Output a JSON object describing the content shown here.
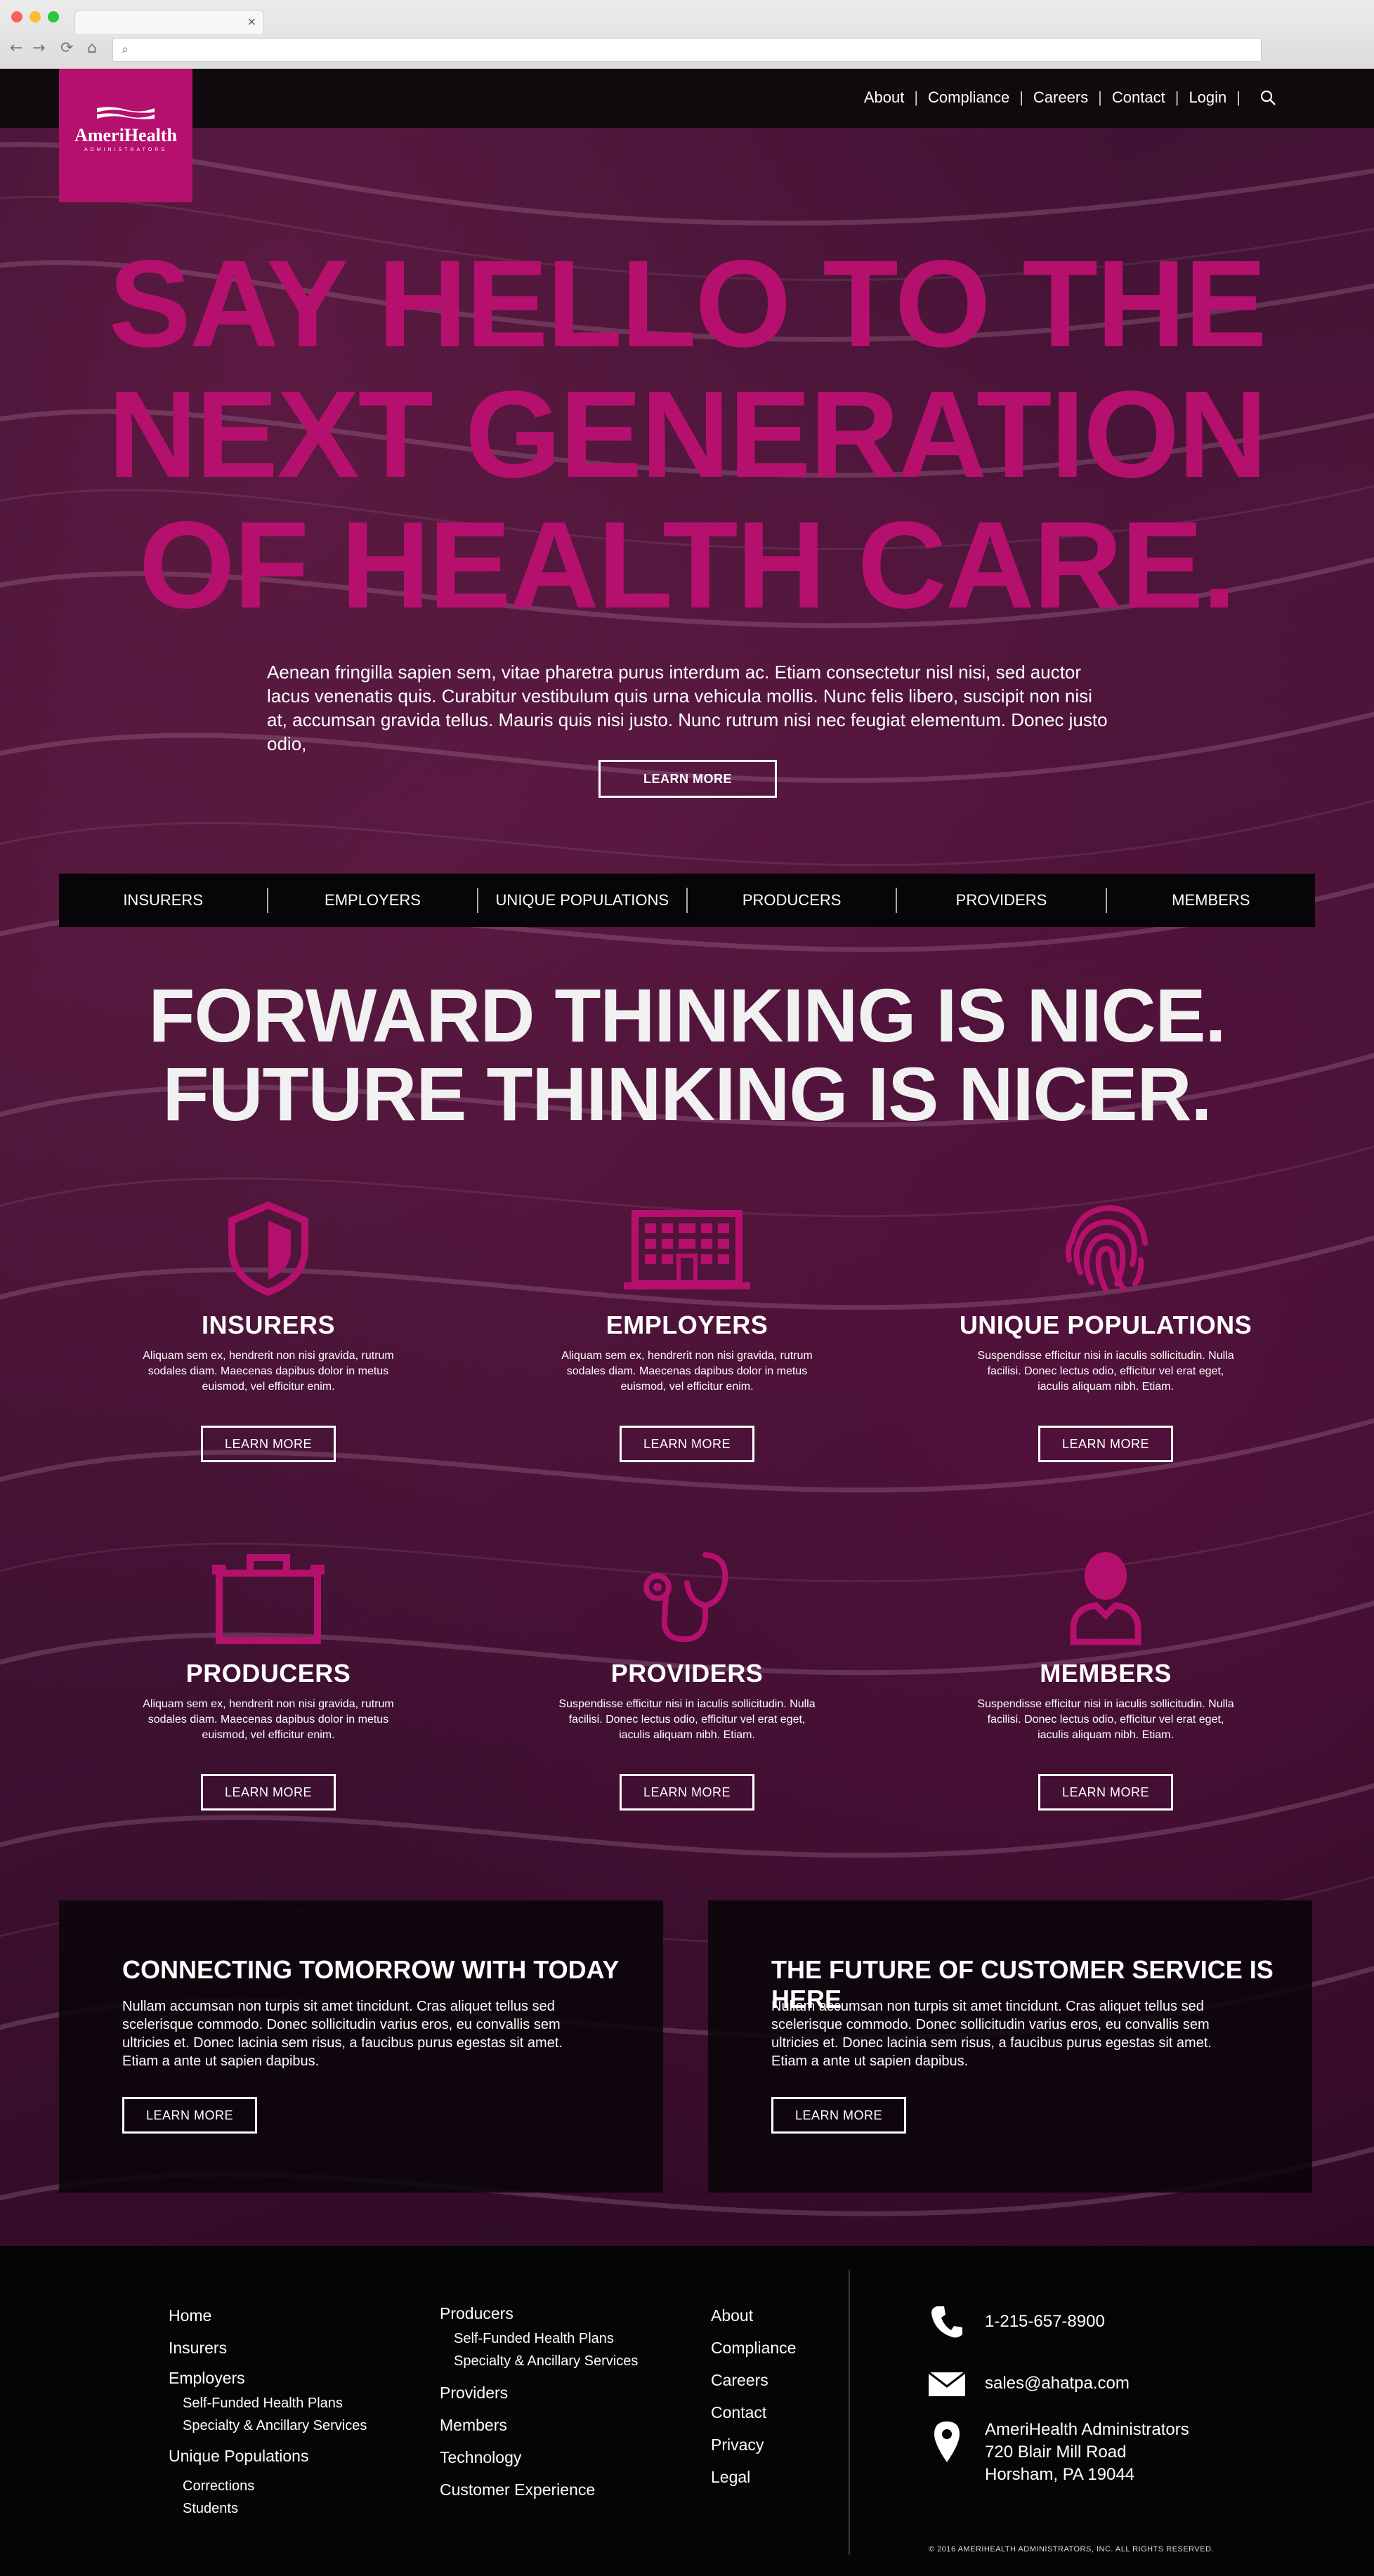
{
  "nav": {
    "links": [
      "About",
      "Compliance",
      "Careers",
      "Contact",
      "Login"
    ]
  },
  "logo": {
    "brand": "AmeriHealth",
    "sub": "ADMINISTRATORS"
  },
  "hero": {
    "title_lines": [
      "SAY HELLO TO THE",
      "NEXT GENERATION",
      "OF HEALTH CARE."
    ],
    "body": "Aenean fringilla sapien sem, vitae pharetra purus interdum ac. Etiam consectetur nisl nisi, sed auctor lacus venenatis quis. Curabitur vestibulum quis urna vehicula mollis. Nunc felis libero, suscipit non nisi at, accumsan gravida tellus. Mauris quis nisi justo. Nunc rutrum nisi nec feugiat elementum. Donec justo odio,",
    "button": "LEARN MORE"
  },
  "section_bar": [
    "INSURERS",
    "EMPLOYERS",
    "UNIQUE POPULATIONS",
    "PRODUCERS",
    "PROVIDERS",
    "MEMBERS"
  ],
  "tagline": [
    "FORWARD THINKING IS NICE.",
    "FUTURE THINKING IS NICER."
  ],
  "cards": [
    {
      "title": "INSURERS",
      "icon": "shield-icon",
      "desc": "Aliquam sem ex, hendrerit non nisi gravida, rutrum sodales diam. Maecenas dapibus dolor in metus euismod, vel efficitur enim.",
      "button": "LEARN MORE"
    },
    {
      "title": "EMPLOYERS",
      "icon": "building-icon",
      "desc": "Aliquam sem ex, hendrerit non nisi gravida, rutrum sodales diam. Maecenas dapibus dolor in metus euismod, vel efficitur enim.",
      "button": "LEARN MORE"
    },
    {
      "title": "UNIQUE POPULATIONS",
      "icon": "fingerprint-icon",
      "desc": "Suspendisse efficitur nisi in iaculis sollicitudin. Nulla facilisi. Donec lectus odio, efficitur vel erat eget, iaculis aliquam nibh. Etiam.",
      "button": "LEARN MORE"
    },
    {
      "title": "PRODUCERS",
      "icon": "briefcase-icon",
      "desc": "Aliquam sem ex, hendrerit non nisi gravida, rutrum sodales diam. Maecenas dapibus dolor in metus euismod, vel efficitur enim.",
      "button": "LEARN MORE"
    },
    {
      "title": "PROVIDERS",
      "icon": "stethoscope-icon",
      "desc": "Suspendisse efficitur nisi in iaculis sollicitudin. Nulla facilisi. Donec lectus odio, efficitur vel erat eget, iaculis aliquam nibh. Etiam.",
      "button": "LEARN MORE"
    },
    {
      "title": "MEMBERS",
      "icon": "person-icon",
      "desc": "Suspendisse efficitur nisi in iaculis sollicitudin. Nulla facilisi. Donec lectus odio, efficitur vel erat eget, iaculis aliquam nibh. Etiam.",
      "button": "LEARN MORE"
    }
  ],
  "promos": [
    {
      "title": "CONNECTING TOMORROW WITH TODAY",
      "text": "Nullam accumsan non turpis sit amet tincidunt. Cras aliquet tellus sed scelerisque commodo. Donec sollicitudin varius eros, eu convallis sem ultricies et. Donec lacinia sem risus, a faucibus purus egestas sit amet. Etiam a ante ut sapien dapibus.",
      "button": "LEARN MORE"
    },
    {
      "title": "THE FUTURE OF CUSTOMER SERVICE IS HERE",
      "text": "Nullam accumsan non turpis sit amet tincidunt. Cras aliquet tellus sed scelerisque commodo. Donec sollicitudin varius eros, eu convallis sem ultricies et. Donec lacinia sem risus, a faucibus purus egestas sit amet. Etiam a ante ut sapien dapibus.",
      "button": "LEARN MORE"
    }
  ],
  "footer": {
    "col1": {
      "home": "Home",
      "insurers": "Insurers",
      "employers": "Employers",
      "emp_sub1": "Self-Funded Health Plans",
      "emp_sub2": "Specialty & Ancillary Services",
      "unique": "Unique  Populations",
      "uni_sub1": "Corrections",
      "uni_sub2": "Students"
    },
    "col2": {
      "producers": "Producers",
      "prod_sub1": "Self-Funded Health Plans",
      "prod_sub2": "Specialty & Ancillary Services",
      "providers": "Providers",
      "members": "Members",
      "technology": "Technology",
      "cx": "Customer Experience"
    },
    "col3": [
      "About",
      "Compliance",
      "Careers",
      "Contact",
      "Privacy",
      "Legal"
    ],
    "phone": "1-215-657-8900",
    "email": "sales@ahatpa.com",
    "address": [
      "AmeriHealth Administrators",
      "720 Blair Mill Road",
      "Horsham, PA 19044"
    ],
    "copyright": "© 2016 AMERIHEALTH ADMINISTRATORS, INC. ALL RIGHTS RESERVED."
  },
  "colors": {
    "accent": "#b5106e",
    "background": "#3a1030",
    "footer": "#050505"
  }
}
